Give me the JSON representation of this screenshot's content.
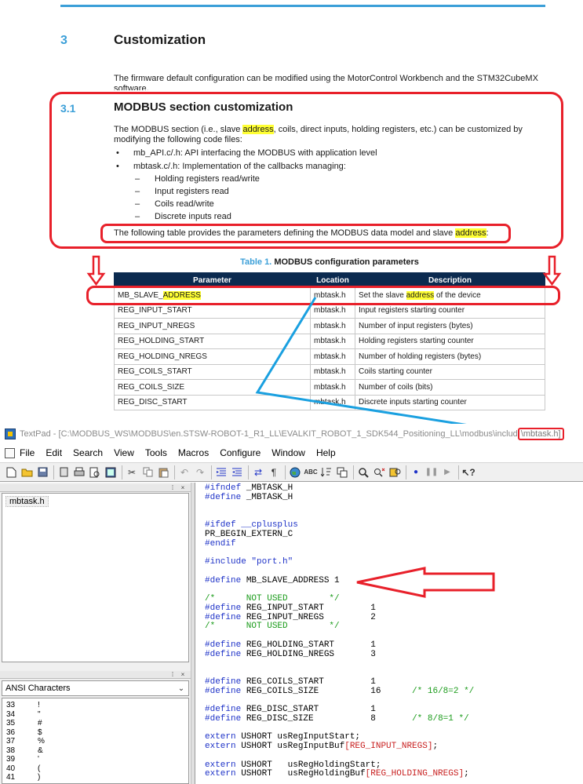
{
  "doc": {
    "section_number": "3",
    "section_title": "Customization",
    "intro_line1": "The firmware default configuration can be modified using the MotorControl Workbench and the STM32CubeMX",
    "intro_line2": "software.",
    "subsection_number": "3.1",
    "subsection_title": "MODBUS section customization",
    "body_pre": "The MODBUS section (i.e., slave ",
    "body_hl": "address",
    "body_post": ", coils, direct inputs, holding registers, etc.) can be customized by",
    "body_line2": "modifying the following code files:",
    "bullets": [
      "mb_API.c/.h: API interfacing the MODBUS with application level",
      "mbtask.c/.h: Implementation of the callbacks managing:"
    ],
    "bullet_symbol": "•",
    "dash_symbol": "–",
    "subbullets": [
      "Holding registers read/write",
      "Input registers read",
      "Coils read/write",
      "Discrete inputs read"
    ],
    "table_intro_pre": "The following table provides the parameters defining the MODBUS data model and slave ",
    "table_intro_hl": "address",
    "table_intro_post": ":",
    "table_caption_label": "Table 1.",
    "table_caption_text": "MODBUS configuration parameters",
    "table_headers": [
      "Parameter",
      "Location",
      "Description"
    ],
    "table_rows": [
      {
        "param_pre": "MB_SLAVE_",
        "param_hl": "ADDRESS",
        "location": "mbtask.h",
        "desc_pre": "Set the slave ",
        "desc_hl": "address",
        "desc_post": " of the device"
      },
      {
        "param_pre": "REG_INPUT_START",
        "param_hl": "",
        "location": "mbtask.h",
        "desc_pre": "Input registers starting counter",
        "desc_hl": "",
        "desc_post": ""
      },
      {
        "param_pre": "REG_INPUT_NREGS",
        "param_hl": "",
        "location": "mbtask.h",
        "desc_pre": "Number of input registers (bytes)",
        "desc_hl": "",
        "desc_post": ""
      },
      {
        "param_pre": "REG_HOLDING_START",
        "param_hl": "",
        "location": "mbtask.h",
        "desc_pre": "Holding registers starting counter",
        "desc_hl": "",
        "desc_post": ""
      },
      {
        "param_pre": "REG_HOLDING_NREGS",
        "param_hl": "",
        "location": "mbtask.h",
        "desc_pre": "Number of holding registers (bytes)",
        "desc_hl": "",
        "desc_post": ""
      },
      {
        "param_pre": "REG_COILS_START",
        "param_hl": "",
        "location": "mbtask.h",
        "desc_pre": "Coils starting counter",
        "desc_hl": "",
        "desc_post": ""
      },
      {
        "param_pre": "REG_COILS_SIZE",
        "param_hl": "",
        "location": "mbtask.h",
        "desc_pre": "Number of coils (bits)",
        "desc_hl": "",
        "desc_post": ""
      },
      {
        "param_pre": "REG_DISC_START",
        "param_hl": "",
        "location": "mbtask.h",
        "desc_pre": "Discrete inputs starting counter",
        "desc_hl": "",
        "desc_post": ""
      }
    ]
  },
  "textpad": {
    "title_prefix": "TextPad - [C:\\MODBUS_WS\\MODBUS\\en.STSW-ROBOT-1_R1_LL\\EVALKIT_ROBOT_1_SDK544_Positioning_LL\\modbus\\includ",
    "title_file": "\\mbtask.h]",
    "menu": [
      "File",
      "Edit",
      "Search",
      "View",
      "Tools",
      "Macros",
      "Configure",
      "Window",
      "Help"
    ],
    "open_file": "mbtask.h",
    "clip_library": "ANSI Characters",
    "characters": [
      {
        "code": "33",
        "ch": "!"
      },
      {
        "code": "34",
        "ch": "\""
      },
      {
        "code": "35",
        "ch": "#"
      },
      {
        "code": "36",
        "ch": "$"
      },
      {
        "code": "37",
        "ch": "%"
      },
      {
        "code": "38",
        "ch": "&"
      },
      {
        "code": "39",
        "ch": "'"
      },
      {
        "code": "40",
        "ch": "("
      },
      {
        "code": "41",
        "ch": ")"
      }
    ],
    "code_lines": [
      {
        "k": "#ifndef",
        "t": " _MBTASK_H"
      },
      {
        "k": "#define",
        "t": " _MBTASK_H"
      },
      {
        "k": "",
        "t": ""
      },
      {
        "k": "",
        "t": ""
      },
      {
        "k": "#ifdef",
        "t": " __cplusplus",
        "tc": "kw"
      },
      {
        "k": "",
        "t": "PR_BEGIN_EXTERN_C"
      },
      {
        "k": "#endif",
        "t": ""
      },
      {
        "k": "",
        "t": ""
      },
      {
        "k": "#include",
        "t": " \"port.h\"",
        "tc": "kw"
      },
      {
        "k": "",
        "t": ""
      },
      {
        "k": "#define",
        "t": " MB_SLAVE_ADDRESS 1"
      },
      {
        "k": "",
        "t": ""
      },
      {
        "k": "",
        "t": "/*      NOT USED        */",
        "tc": "cm"
      },
      {
        "k": "#define",
        "t": " REG_INPUT_START         1"
      },
      {
        "k": "#define",
        "t": " REG_INPUT_NREGS         2"
      },
      {
        "k": "",
        "t": "/*      NOT USED        */",
        "tc": "cm"
      },
      {
        "k": "",
        "t": ""
      },
      {
        "k": "#define",
        "t": " REG_HOLDING_START       1"
      },
      {
        "k": "#define",
        "t": " REG_HOLDING_NREGS       3"
      },
      {
        "k": "",
        "t": ""
      },
      {
        "k": "",
        "t": ""
      },
      {
        "k": "#define",
        "t": " REG_COILS_START         1"
      },
      {
        "k": "#define",
        "t": " REG_COILS_SIZE          16",
        "c": "      /* 16/8=2 */"
      },
      {
        "k": "",
        "t": ""
      },
      {
        "k": "#define",
        "t": " REG_DISC_START          1"
      },
      {
        "k": "#define",
        "t": " REG_DISC_SIZE           8",
        "c": "       /* 8/8=1 */"
      },
      {
        "k": "",
        "t": ""
      },
      {
        "k": "extern",
        "t": " USHORT usRegInputStart;"
      },
      {
        "k": "extern",
        "t": " USHORT usRegInputBuf",
        "b": "[REG_INPUT_NREGS]",
        "e": ";"
      },
      {
        "k": "",
        "t": ""
      },
      {
        "k": "extern",
        "t": " USHORT   usRegHoldingStart;"
      },
      {
        "k": "extern",
        "t": " USHORT   usRegHoldingBuf",
        "b": "[REG_HOLDING_NREGS]",
        "e": ";"
      }
    ]
  },
  "colors": {
    "accent_blue": "#3b9fd8",
    "annotation_red": "#e8202a",
    "highlight_yellow": "#ffff33",
    "table_header": "#0b2a4f",
    "code_keyword": "#1f33c8",
    "code_comment": "#1a9b1a",
    "code_bracket": "#c82020"
  }
}
